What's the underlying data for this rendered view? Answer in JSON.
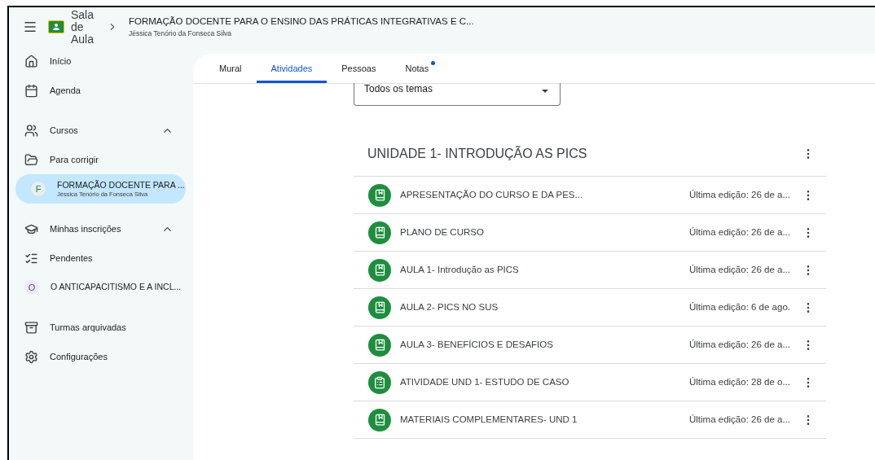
{
  "header": {
    "app_name": "Sala de Aula",
    "course_title": "FORMAÇÃO DOCENTE PARA O ENSINO DAS PRÁTICAS INTEGRATIVAS E C...",
    "course_owner": "Jéssica Tenório da Fonseca Silva"
  },
  "sidebar": {
    "groups": [
      {
        "items": [
          {
            "kind": "nav",
            "label": "Início"
          },
          {
            "kind": "nav",
            "label": "Agenda"
          }
        ]
      },
      {
        "items": [
          {
            "kind": "section",
            "label": "Cursos",
            "expanded": true
          },
          {
            "kind": "nav",
            "label": "Para corrigir"
          },
          {
            "kind": "course",
            "letter": "F",
            "color": "#188038",
            "label": "FORMAÇÃO DOCENTE PARA ...",
            "sublabel": "Jéssica Tenório da Fonseca Silva",
            "selected": true
          }
        ]
      },
      {
        "items": [
          {
            "kind": "section",
            "label": "Minhas inscrições",
            "expanded": true
          },
          {
            "kind": "nav",
            "label": "Pendentes"
          },
          {
            "kind": "course",
            "letter": "O",
            "color": "#7627bb",
            "label": "O ANTICAPACITISMO E A INCL...",
            "selected": false
          }
        ]
      },
      {
        "items": [
          {
            "kind": "nav",
            "label": "Turmas arquivadas"
          },
          {
            "kind": "nav",
            "label": "Configurações"
          }
        ]
      }
    ]
  },
  "tabs": [
    {
      "label": "Mural",
      "selected": false,
      "dot": false
    },
    {
      "label": "Atividades",
      "selected": true,
      "dot": false
    },
    {
      "label": "Pessoas",
      "selected": false,
      "dot": false
    },
    {
      "label": "Notas",
      "selected": false,
      "dot": true
    }
  ],
  "topic_filter": {
    "value": "Todos os temas"
  },
  "topic": {
    "title": "UNIDADE 1- INTRODUÇÃO AS PICS",
    "items": [
      {
        "kind": "material",
        "title": "APRESENTAÇÃO DO CURSO E DA PES...",
        "edited": "Última edição: 26 de a..."
      },
      {
        "kind": "material",
        "title": "PLANO DE CURSO",
        "edited": "Última edição: 26 de a..."
      },
      {
        "kind": "material",
        "title": "AULA 1- Introdução as PICS",
        "edited": "Última edição: 26 de a..."
      },
      {
        "kind": "material",
        "title": "AULA 2- PICS NO SUS",
        "edited": "Última edição: 6 de ago."
      },
      {
        "kind": "material",
        "title": "AULA 3- BENEFÍCIOS E DESAFIOS",
        "edited": "Última edição: 26 de a..."
      },
      {
        "kind": "assignment",
        "title": "ATIVIDADE UND 1- ESTUDO DE CASO",
        "edited": "Última edição: 28 de o..."
      },
      {
        "kind": "material",
        "title": "MATERIAIS COMPLEMENTARES- UND 1",
        "edited": "Última edição: 26 de a..."
      }
    ]
  }
}
